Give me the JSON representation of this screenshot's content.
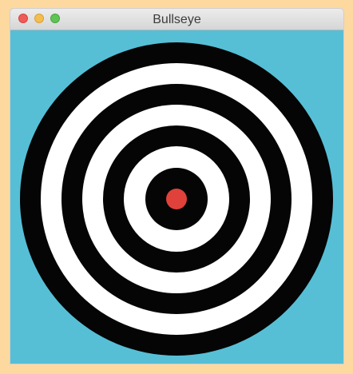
{
  "window": {
    "title": "Bullseye"
  },
  "target": {
    "ring_colors": [
      "#050505",
      "#ffffff",
      "#050505",
      "#ffffff",
      "#050505",
      "#ffffff",
      "#050505"
    ],
    "center_color": "#e0413a",
    "background_color": "#56bfd6"
  }
}
